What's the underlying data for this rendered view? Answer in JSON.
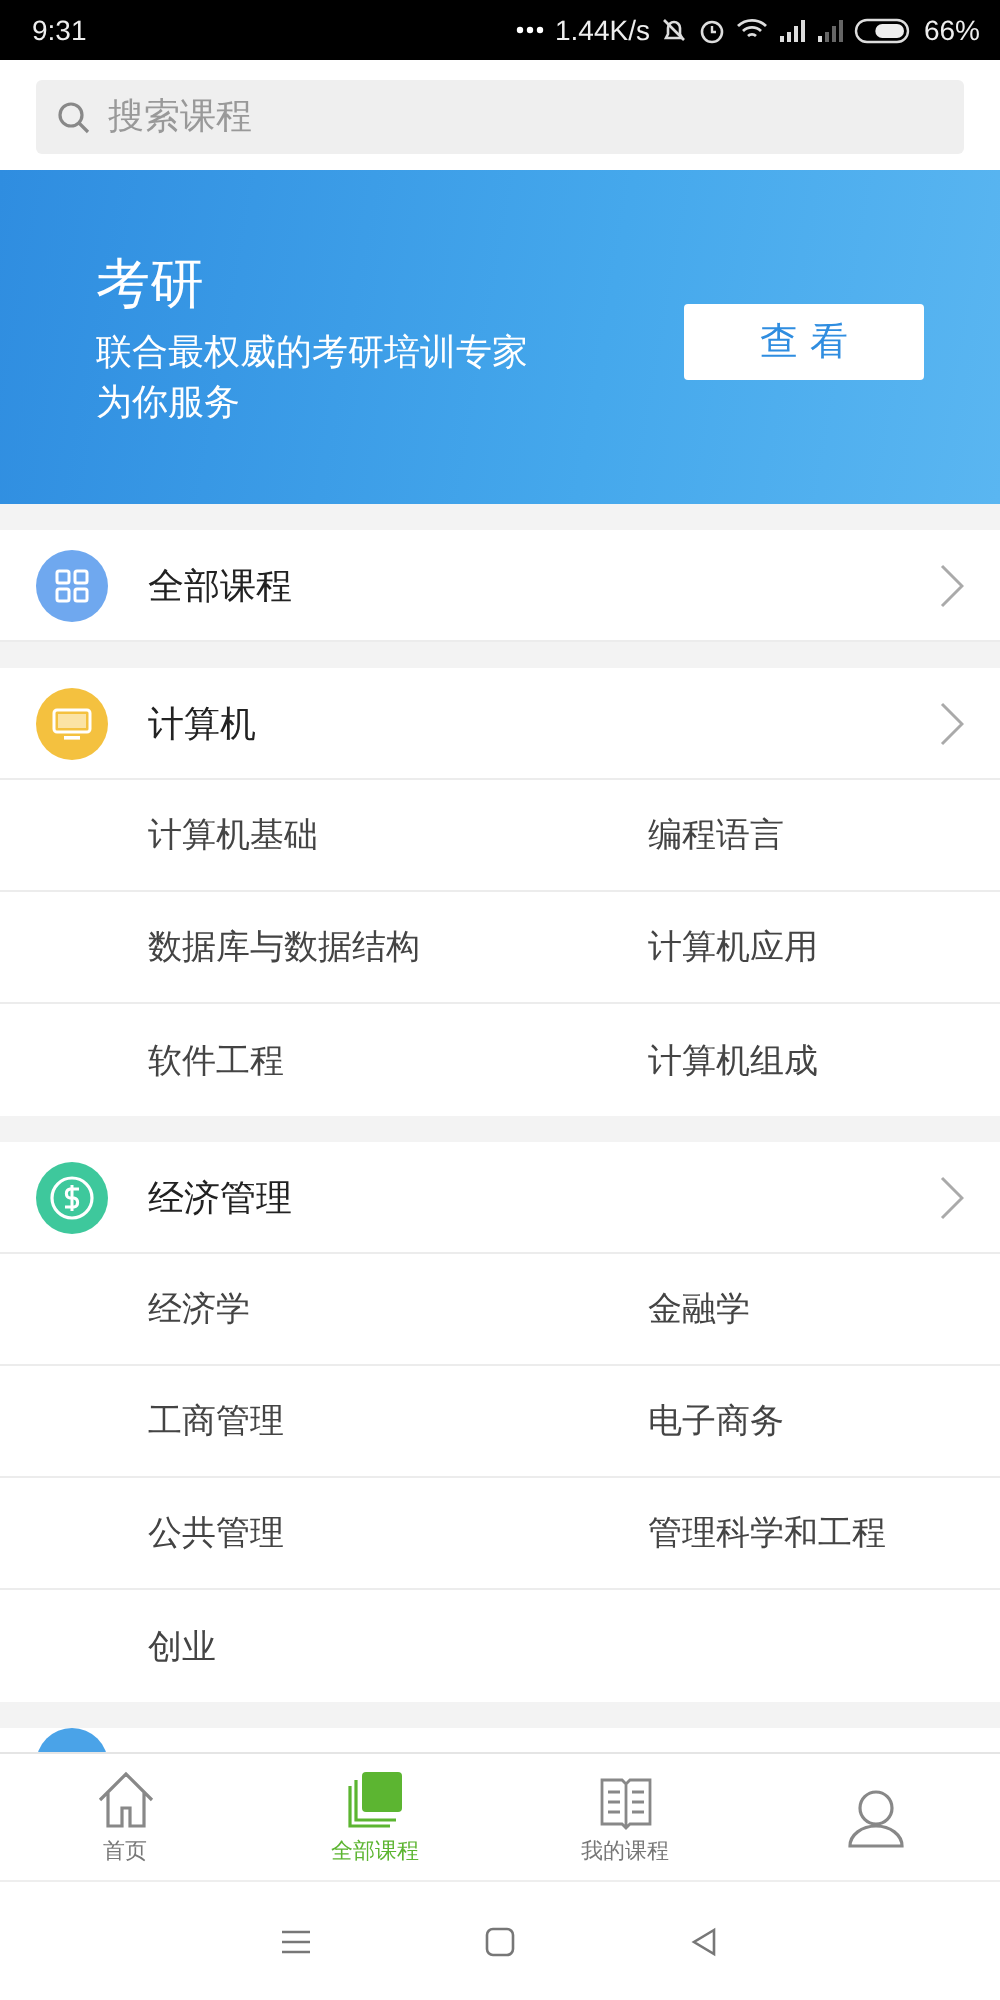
{
  "status_bar": {
    "time": "9:31",
    "speed": "1.44K/s",
    "battery": "66%"
  },
  "search": {
    "placeholder": "搜索课程"
  },
  "banner": {
    "title": "考研",
    "lines": [
      "联合最权威的考研培训专家",
      "为你服务"
    ],
    "button": "查 看"
  },
  "categories": [
    {
      "name": "全部课程",
      "kind": "grid",
      "color": "#6fa8ef"
    },
    {
      "name": "计算机",
      "kind": "monitor",
      "color": "#f4c13f",
      "subcategories": [
        "计算机基础",
        "编程语言",
        "数据库与数据结构",
        "计算机应用",
        "软件工程",
        "计算机组成"
      ]
    },
    {
      "name": "经济管理",
      "kind": "coin",
      "color": "#3ec89c",
      "subcategories": [
        "经济学",
        "金融学",
        "工商管理",
        "电子商务",
        "公共管理",
        "管理科学和工程",
        "创业"
      ]
    }
  ],
  "next_category": {
    "color": "#4aa3e8"
  },
  "tabs": [
    {
      "label": "首页",
      "kind": "house",
      "selected": false
    },
    {
      "label": "全部课程",
      "kind": "stack",
      "selected": true
    },
    {
      "label": "我的课程",
      "kind": "book",
      "selected": false
    },
    {
      "kind": "person",
      "selected": false
    }
  ]
}
